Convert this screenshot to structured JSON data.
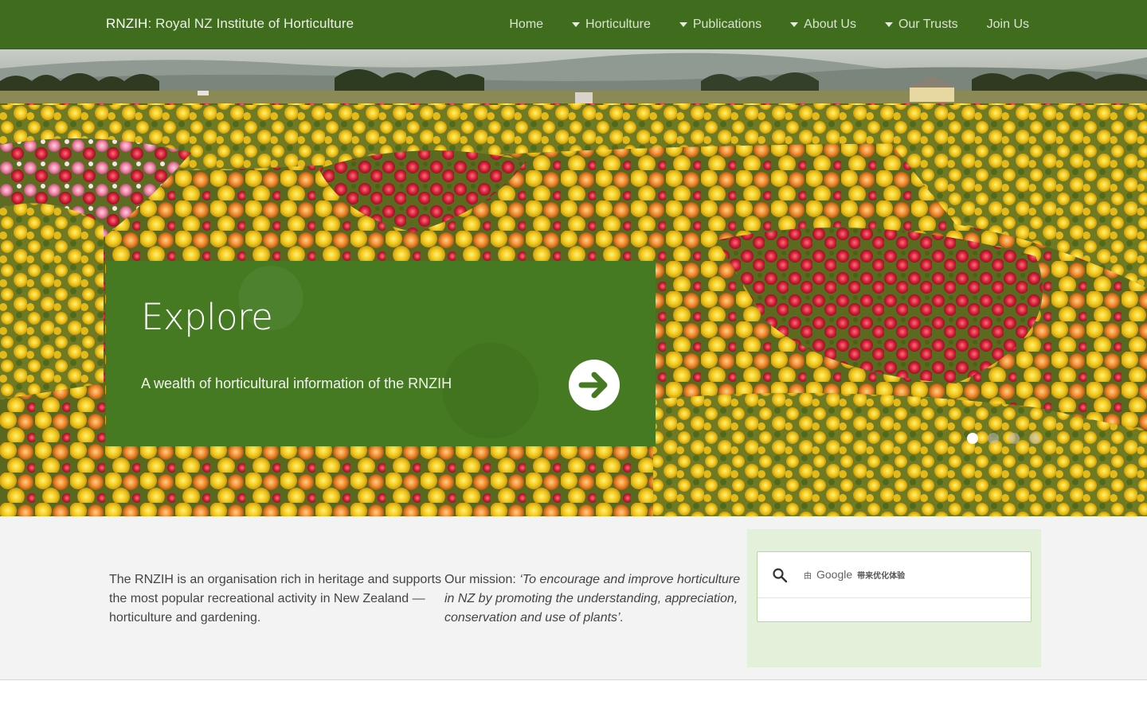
{
  "header": {
    "brand_short": "RNZIH",
    "brand_separator": ":",
    "brand_full": "Royal NZ Institute of Horticulture",
    "background_color": "#3f6d1d",
    "nav": [
      {
        "label": "Home",
        "has_dropdown": false
      },
      {
        "label": "Horticulture",
        "has_dropdown": true
      },
      {
        "label": "Publications",
        "has_dropdown": true
      },
      {
        "label": "About Us",
        "has_dropdown": true
      },
      {
        "label": "Our Trusts",
        "has_dropdown": true
      },
      {
        "label": "Join Us",
        "has_dropdown": false
      }
    ]
  },
  "hero": {
    "title": "Explore",
    "subtitle": "A wealth of horticultural information of the RNZIH",
    "arrow_icon": "arrow-right-circle-icon",
    "slide_count": 4,
    "active_slide": 1,
    "overlay_color": "#457a22"
  },
  "content": {
    "intro_text": "The RNZIH is an organisation rich in heritage and supports the most popular recreational activity in New Zealand — horticulture and gardening.",
    "mission_label": "Our mission:",
    "mission_quote": "‘To encourage and improve horticulture in NZ by promoting the understanding, appreciation, conservation and use of plants’."
  },
  "search": {
    "icon": "search-icon",
    "value": "",
    "placeholder": "",
    "watermark_prefix": "由",
    "watermark_logo": "Google",
    "watermark_suffix": "带来优化体验",
    "panel_color": "#e4f1da"
  }
}
